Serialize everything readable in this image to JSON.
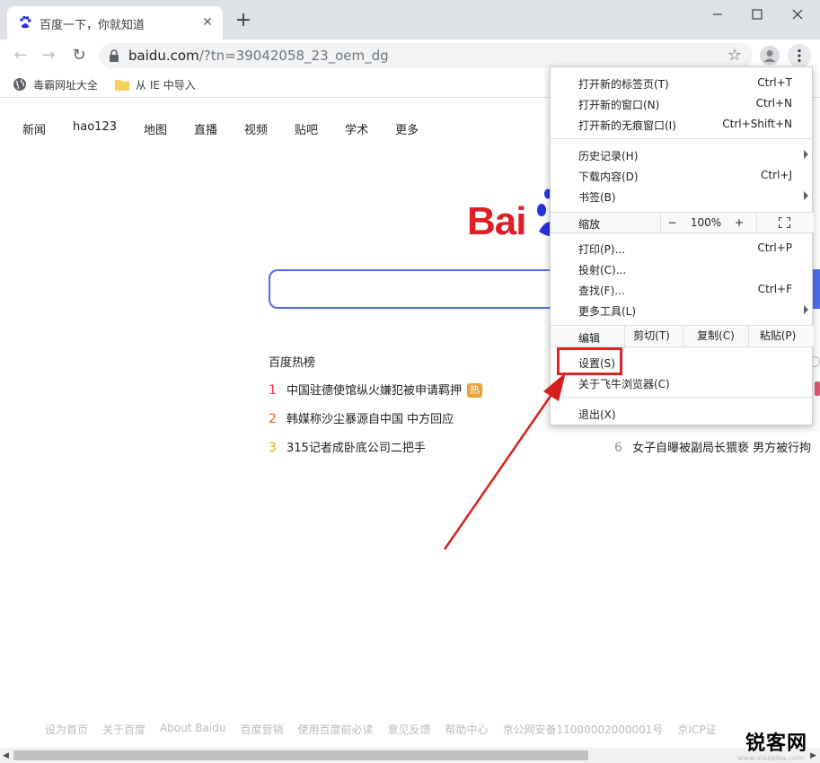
{
  "tab": {
    "title": "百度一下，你就知道",
    "close_glyph": "✕"
  },
  "newtab": {
    "glyph": "+"
  },
  "window": {
    "minimize": "—",
    "maximize": "☐",
    "close": "✕"
  },
  "nav": {
    "back": "←",
    "forward": "→",
    "reload": "↻"
  },
  "address": {
    "domain": "baidu.com",
    "query": "/?tn=39042058_23_oem_dg",
    "star": "☆"
  },
  "bookmarks": [
    {
      "label": "毒霸网址大全",
      "icon": "globe-icon"
    },
    {
      "label": "从 IE 中导入",
      "icon": "folder-icon"
    }
  ],
  "page": {
    "topnav": [
      "新闻",
      "hao123",
      "地图",
      "直播",
      "视频",
      "贴吧",
      "学术",
      "更多"
    ],
    "logo_text": "Bai",
    "hot_title": "百度热榜",
    "hot_list": [
      {
        "rank": "1",
        "text": "中国驻德使馆纵火嫌犯被申请羁押",
        "badge": "热",
        "rank_color": "#fe2d46"
      },
      {
        "rank": "2",
        "text": "韩媒称沙尘暴源自中国 中方回应",
        "badge": "",
        "rank_color": "#ff6600"
      },
      {
        "rank": "3",
        "text": "315记者成卧底公司二把手",
        "badge": "",
        "rank_color": "#faa90e"
      }
    ],
    "hot_right": {
      "rank": "6",
      "text": "女子自曝被副局长猥亵 男方被行拘"
    },
    "footer": [
      "设为首页",
      "关于百度",
      "About Baidu",
      "百度营销",
      "使用百度前必读",
      "意见反馈",
      "帮助中心",
      "京公网安备11000002000001号",
      "京ICP证"
    ]
  },
  "menu": {
    "group1": [
      {
        "label": "打开新的标签页(T)",
        "shortcut": "Ctrl+T"
      },
      {
        "label": "打开新的窗口(N)",
        "shortcut": "Ctrl+N"
      },
      {
        "label": "打开新的无痕窗口(I)",
        "shortcut": "Ctrl+Shift+N"
      }
    ],
    "group2": [
      {
        "label": "历史记录(H)",
        "shortcut": "",
        "submenu": true
      },
      {
        "label": "下载内容(D)",
        "shortcut": "Ctrl+J",
        "submenu": false
      },
      {
        "label": "书签(B)",
        "shortcut": "",
        "submenu": true
      }
    ],
    "zoom": {
      "label": "缩放",
      "minus": "−",
      "value": "100%",
      "plus": "+"
    },
    "group3": [
      {
        "label": "打印(P)...",
        "shortcut": "Ctrl+P",
        "submenu": false
      },
      {
        "label": "投射(C)...",
        "shortcut": "",
        "submenu": false
      },
      {
        "label": "查找(F)...",
        "shortcut": "Ctrl+F",
        "submenu": false
      },
      {
        "label": "更多工具(L)",
        "shortcut": "",
        "submenu": true
      }
    ],
    "edit": {
      "label": "编辑",
      "cut": "剪切(T)",
      "copy": "复制(C)",
      "paste": "粘贴(P)"
    },
    "settings": "设置(S)",
    "about": "关于飞牛浏览器(C)",
    "exit": "退出(X)"
  },
  "watermark": {
    "text": "锐客网",
    "url": "www.xiazaiba.com"
  },
  "colors": {
    "accent": "#4e6ef2",
    "brand_red": "#de1f26",
    "highlight": "#e02525",
    "arrow": "#d42020"
  }
}
